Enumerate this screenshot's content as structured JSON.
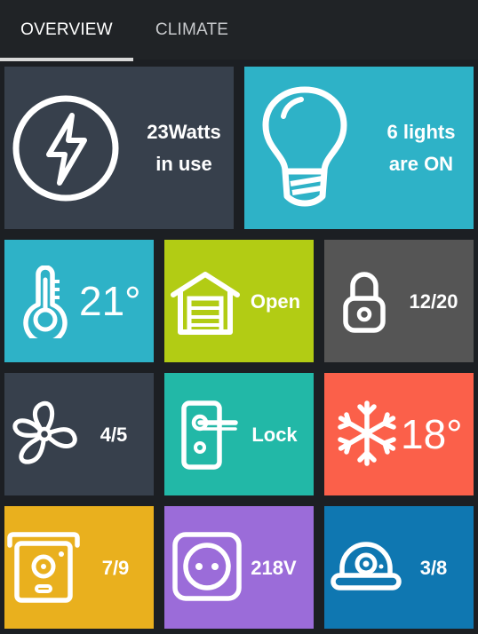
{
  "tabs": [
    {
      "label": "OVERVIEW",
      "active": true
    },
    {
      "label": "CLIMATE",
      "active": false
    }
  ],
  "tiles": {
    "power": {
      "line1": "23Watts",
      "line2": "in use",
      "icon": "lightning-bolt-icon",
      "color": "#37404c"
    },
    "lights": {
      "line1": "6 lights",
      "line2": "are ON",
      "icon": "light-bulb-icon",
      "color": "#2eb2c7"
    },
    "temperature": {
      "value": "21°",
      "icon": "thermometer-icon",
      "color": "#2eb2c7"
    },
    "garage": {
      "value": "Open",
      "icon": "garage-icon",
      "color": "#b2cc14"
    },
    "locks": {
      "value": "12/20",
      "icon": "padlock-icon",
      "color": "#555555"
    },
    "fan": {
      "value": "4/5",
      "icon": "fan-icon",
      "color": "#37404c"
    },
    "door": {
      "value": "Lock",
      "icon": "door-handle-icon",
      "color": "#22b8a7"
    },
    "cooling": {
      "value": "18°",
      "icon": "snowflake-icon",
      "color": "#fb604a"
    },
    "speaker": {
      "value": "7/9",
      "icon": "speaker-icon",
      "color": "#e9b01e"
    },
    "outlet": {
      "value": "218V",
      "icon": "power-outlet-icon",
      "color": "#9b6cd9"
    },
    "camera": {
      "value": "3/8",
      "icon": "dome-camera-icon",
      "color": "#0f77b1"
    }
  }
}
